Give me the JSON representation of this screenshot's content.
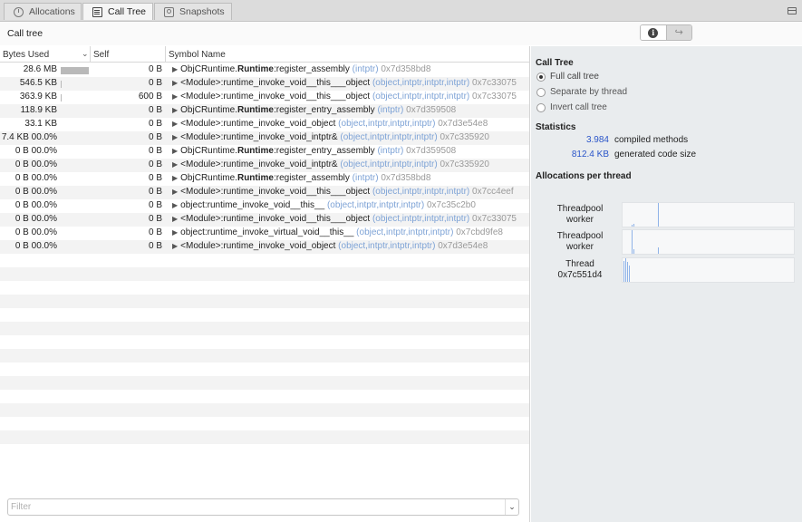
{
  "tabs": [
    {
      "label": "Allocations",
      "icon": "stopwatch-icon"
    },
    {
      "label": "Call Tree",
      "icon": "call-tree-icon"
    },
    {
      "label": "Snapshots",
      "icon": "camera-icon"
    }
  ],
  "header": {
    "title": "Call tree"
  },
  "columns": {
    "bytes_used": "Bytes Used",
    "self": "Self",
    "symbol_name": "Symbol Name"
  },
  "rows": [
    {
      "bytes": "28.6 MB",
      "bar_fraction": 1.0,
      "self": "0 B",
      "prefix": "ObjCRuntime.",
      "bold": "Runtime",
      "method": ":register_assembly",
      "args": "(intptr)",
      "addr": "0x7d358bd8"
    },
    {
      "bytes": "546.5 KB",
      "bar_fraction": 0.02,
      "self": "0 B",
      "prefix": "<Module>:runtime_invoke_void__this___object",
      "bold": "",
      "method": "",
      "args": "(object,intptr,intptr,intptr)",
      "addr": "0x7c33075"
    },
    {
      "bytes": "363.9 KB",
      "bar_fraction": 0.01,
      "self": "600 B",
      "prefix": "<Module>:runtime_invoke_void__this___object",
      "bold": "",
      "method": "",
      "args": "(object,intptr,intptr,intptr)",
      "addr": "0x7c33075"
    },
    {
      "bytes": "118.9 KB",
      "bar_fraction": 0,
      "self": "0 B",
      "prefix": "ObjCRuntime.",
      "bold": "Runtime",
      "method": ":register_entry_assembly",
      "args": "(intptr)",
      "addr": "0x7d359508"
    },
    {
      "bytes": "33.1 KB",
      "bar_fraction": 0,
      "self": "0 B",
      "prefix": "<Module>:runtime_invoke_void_object",
      "bold": "",
      "method": "",
      "args": "(object,intptr,intptr,intptr)",
      "addr": "0x7d3e54e8"
    },
    {
      "bytes": "7.4 KB 00.0%",
      "bar_fraction": 0,
      "self": "0 B",
      "prefix": "<Module>:runtime_invoke_void_intptr&",
      "bold": "",
      "method": "",
      "args": "(object,intptr,intptr,intptr)",
      "addr": "0x7c335920"
    },
    {
      "bytes": "0 B 00.0%",
      "bar_fraction": 0,
      "self": "0 B",
      "prefix": "ObjCRuntime.",
      "bold": "Runtime",
      "method": ":register_entry_assembly",
      "args": "(intptr)",
      "addr": "0x7d359508"
    },
    {
      "bytes": "0 B 00.0%",
      "bar_fraction": 0,
      "self": "0 B",
      "prefix": "<Module>:runtime_invoke_void_intptr&",
      "bold": "",
      "method": "",
      "args": "(object,intptr,intptr,intptr)",
      "addr": "0x7c335920"
    },
    {
      "bytes": "0 B 00.0%",
      "bar_fraction": 0,
      "self": "0 B",
      "prefix": "ObjCRuntime.",
      "bold": "Runtime",
      "method": ":register_assembly",
      "args": "(intptr)",
      "addr": "0x7d358bd8"
    },
    {
      "bytes": "0 B 00.0%",
      "bar_fraction": 0,
      "self": "0 B",
      "prefix": "<Module>:runtime_invoke_void__this___object",
      "bold": "",
      "method": "",
      "args": "(object,intptr,intptr,intptr)",
      "addr": "0x7cc4eef"
    },
    {
      "bytes": "0 B 00.0%",
      "bar_fraction": 0,
      "self": "0 B",
      "prefix": "object:runtime_invoke_void__this__",
      "bold": "",
      "method": "",
      "args": "(object,intptr,intptr,intptr)",
      "addr": "0x7c35c2b0"
    },
    {
      "bytes": "0 B 00.0%",
      "bar_fraction": 0,
      "self": "0 B",
      "prefix": "<Module>:runtime_invoke_void__this___object",
      "bold": "",
      "method": "",
      "args": "(object,intptr,intptr,intptr)",
      "addr": "0x7c33075"
    },
    {
      "bytes": "0 B 00.0%",
      "bar_fraction": 0,
      "self": "0 B",
      "prefix": "object:runtime_invoke_virtual_void__this__",
      "bold": "",
      "method": "",
      "args": "(object,intptr,intptr,intptr)",
      "addr": "0x7cbd9fe8"
    },
    {
      "bytes": "0 B 00.0%",
      "bar_fraction": 0,
      "self": "0 B",
      "prefix": "<Module>:runtime_invoke_void_object",
      "bold": "",
      "method": "",
      "args": "(object,intptr,intptr,intptr)",
      "addr": "0x7d3e54e8"
    }
  ],
  "filter": {
    "placeholder": "Filter",
    "value": ""
  },
  "sidebar": {
    "call_tree_heading": "Call Tree",
    "options": [
      {
        "label": "Full call tree",
        "checked": true
      },
      {
        "label": "Separate by thread",
        "checked": false
      },
      {
        "label": "Invert call tree",
        "checked": false
      }
    ],
    "statistics_heading": "Statistics",
    "stats": [
      {
        "value": "3.984",
        "label": "compiled methods"
      },
      {
        "value": "812.4 KB",
        "label": "generated code size"
      }
    ],
    "allocations_heading": "Allocations per thread",
    "threads": [
      {
        "name_line1": "Threadpool",
        "name_line2": "worker",
        "spikes": [
          0.08,
          0.1,
          1.0
        ]
      },
      {
        "name_line1": "Threadpool",
        "name_line2": "worker",
        "spikes": [
          1.0,
          0.2,
          0.25
        ]
      },
      {
        "name_line1": "Thread",
        "name_line2": "0x7c551d4",
        "spikes": [
          0.9,
          1.0,
          0.85,
          0.7
        ]
      }
    ]
  },
  "colors": {
    "accent": "#2a55c9",
    "args": "#7ea3d6",
    "addr": "#9a9a9a",
    "bar": "#b9b9b9",
    "spike": "#8fb3e8"
  }
}
